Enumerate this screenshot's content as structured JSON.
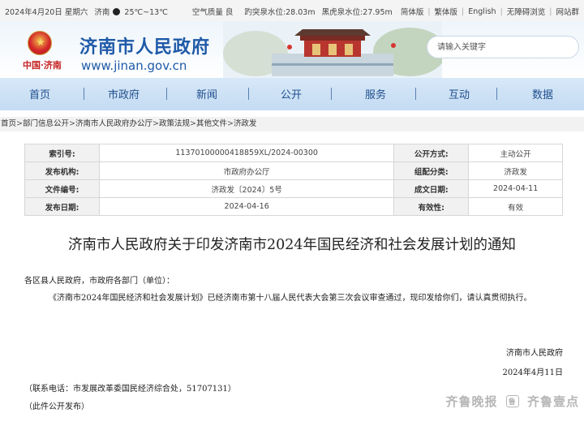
{
  "topbar": {
    "date": "2024年4月20日 星期六",
    "city": "济南",
    "temperature": "25℃~13℃",
    "air_quality": "空气质量 良",
    "baotu_spring": "趵突泉水位:28.03m",
    "black_tiger_spring": "黑虎泉水位:27.95m",
    "links": [
      "简体版",
      "繁体版",
      "English",
      "无障碍浏览",
      "网站群"
    ]
  },
  "header": {
    "site_title": "济南市人民政府",
    "site_url": "www.jinan.gov.cn",
    "brand": "中国·济南",
    "search_placeholder": "请输入关键字"
  },
  "nav": {
    "items": [
      "首页",
      "市政府",
      "新闻",
      "公开",
      "服务",
      "互动",
      "数据"
    ]
  },
  "breadcrumb": [
    "首页",
    "部门信息公开",
    "济南市人民政府办公厅",
    "政策法规",
    "其他文件",
    "济政发"
  ],
  "meta": {
    "rows": [
      {
        "k1": "索引号:",
        "v1": "11370100000418859XL/2024-00300",
        "k2": "公开方式:",
        "v2": "主动公开"
      },
      {
        "k1": "发布机构:",
        "v1": "市政府办公厅",
        "k2": "组配分类:",
        "v2": "济政发"
      },
      {
        "k1": "文件编号:",
        "v1": "济政发〔2024〕5号",
        "k2": "成文日期:",
        "v2": "2024-04-11"
      },
      {
        "k1": "发布日期:",
        "v1": "2024-04-16",
        "k2": "有效性:",
        "v2": "有效"
      }
    ]
  },
  "document": {
    "title": "济南市人民政府关于印发济南市2024年国民经济和社会发展计划的通知",
    "salutation": "各区县人民政府，市政府各部门（单位）：",
    "paragraph": "《济南市2024年国民经济和社会发展计划》已经济南市第十八届人民代表大会第三次会议审查通过，现印发给你们，请认真贯彻执行。",
    "signer": "济南市人民政府",
    "date": "2024年4月11日",
    "contact": "（联系电话：市发展改革委国民经济综合处，51707131）",
    "publish_note": "（此件公开发布）"
  },
  "watermark": {
    "left": "齐鲁晚报",
    "badge": "鲁",
    "right": "齐鲁壹点"
  }
}
